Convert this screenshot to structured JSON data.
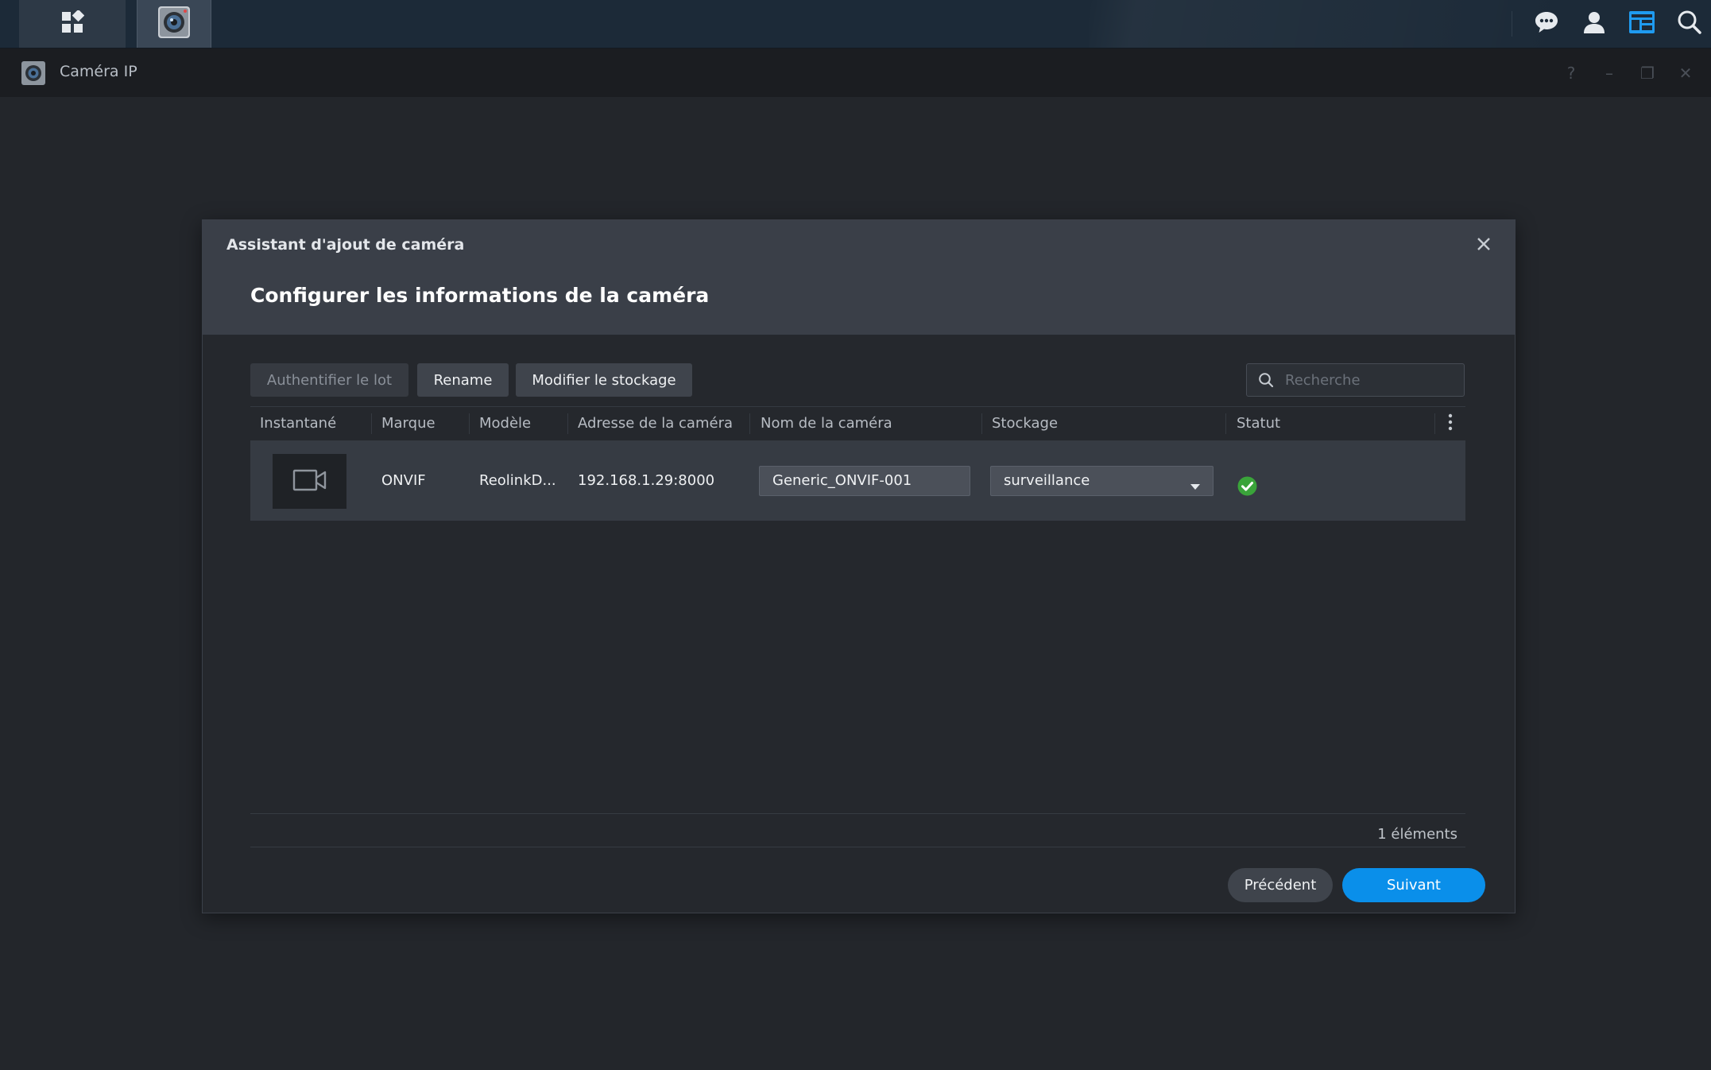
{
  "taskbar": {
    "apps_icon": "apps-grid-icon",
    "active_app_icon": "surveillance-camera-icon",
    "right_icons": [
      "chat-bubble-icon",
      "user-icon",
      "widgets-icon",
      "search-icon"
    ]
  },
  "app_window": {
    "title": "Caméra IP",
    "controls": {
      "help": "?",
      "minimize": "–",
      "restore": "❐",
      "close": "✕"
    }
  },
  "dialog": {
    "title": "Assistant d'ajout de caméra",
    "step_title": "Configurer les informations de la caméra",
    "toolbar": {
      "batch_auth_label": "Authentifier le lot",
      "rename_label": "Rename",
      "modify_storage_label": "Modifier le stockage",
      "search_placeholder": "Recherche"
    },
    "columns": [
      "Instantané",
      "Marque",
      "Modèle",
      "Adresse de la caméra",
      "Nom de la caméra",
      "Stockage",
      "Statut"
    ],
    "rows": [
      {
        "brand": "ONVIF",
        "model": "ReolinkD...",
        "address": "192.168.1.29:8000",
        "camera_name": "Generic_ONVIF-001",
        "storage": "surveillance",
        "status": "ok"
      }
    ],
    "item_count": "1 éléments",
    "footer": {
      "prev_label": "Précédent",
      "next_label": "Suivant"
    }
  },
  "colors": {
    "accent": "#0a8fea",
    "success": "#3aa43a",
    "taskbar": "#1c2a38"
  }
}
